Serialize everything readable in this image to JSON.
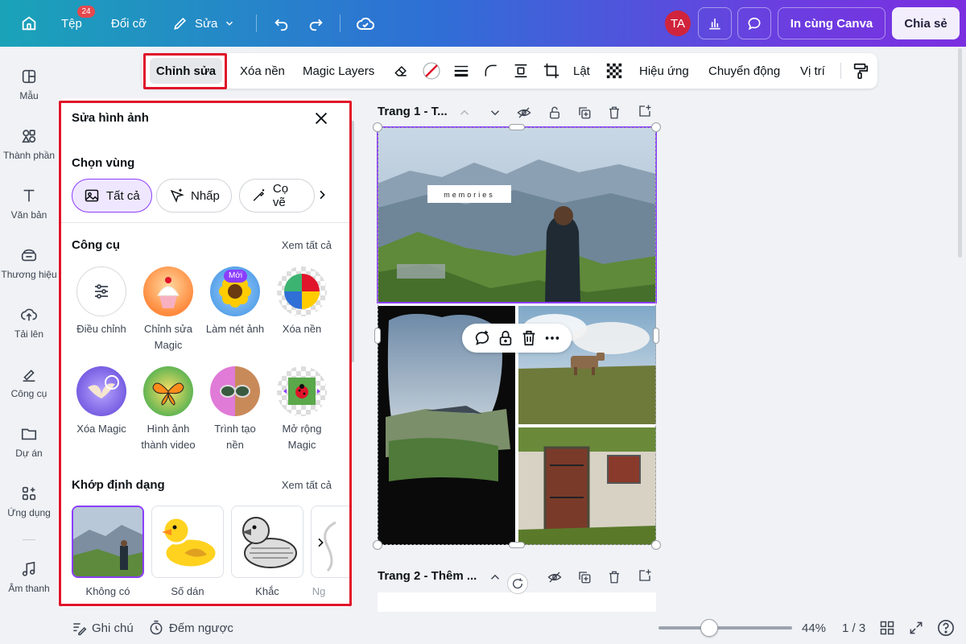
{
  "topbar": {
    "file_label": "Tệp",
    "file_badge": "24",
    "resize_label": "Đổi cỡ",
    "edit_label": "Sửa",
    "avatar_initials": "TA",
    "print_label": "In cùng Canva",
    "share_label": "Chia sẻ"
  },
  "sidebar": {
    "items": [
      {
        "label": "Mẫu",
        "icon": "template-icon"
      },
      {
        "label": "Thành phần",
        "icon": "elements-icon"
      },
      {
        "label": "Văn bản",
        "icon": "text-icon"
      },
      {
        "label": "Thương hiệu",
        "icon": "brand-icon"
      },
      {
        "label": "Tải lên",
        "icon": "upload-icon"
      },
      {
        "label": "Công cụ",
        "icon": "tools-icon"
      },
      {
        "label": "Dự án",
        "icon": "folder-icon"
      },
      {
        "label": "Ứng dụng",
        "icon": "apps-icon"
      },
      {
        "label": "Âm thanh",
        "icon": "music-icon"
      }
    ]
  },
  "context_toolbar": {
    "edit": "Chỉnh sửa",
    "remove_bg": "Xóa nền",
    "magic_layers": "Magic Layers",
    "flip": "Lật",
    "effects": "Hiệu ứng",
    "animate": "Chuyển động",
    "position": "Vị trí"
  },
  "panel": {
    "title": "Sửa hình ảnh",
    "select_area_title": "Chọn vùng",
    "chips": [
      "Tất cả",
      "Nhấp",
      "Cọ vẽ"
    ],
    "tools_title": "Công cụ",
    "see_all": "Xem tất cả",
    "new_badge": "Mới",
    "tools": [
      {
        "line1": "Điều chỉnh",
        "line2": ""
      },
      {
        "line1": "Chỉnh sửa",
        "line2": "Magic"
      },
      {
        "line1": "Làm nét ảnh",
        "line2": ""
      },
      {
        "line1": "Xóa nền",
        "line2": ""
      },
      {
        "line1": "Xóa Magic",
        "line2": ""
      },
      {
        "line1": "Hình ảnh",
        "line2": "thành video"
      },
      {
        "line1": "Trình tạo",
        "line2": "nền"
      },
      {
        "line1": "Mở rộng",
        "line2": "Magic"
      }
    ],
    "styles_title": "Khớp định dạng",
    "styles_see_all": "Xem tất cả",
    "styles": [
      "Không có",
      "Số dán",
      "Khắc",
      "Ng"
    ]
  },
  "canvas": {
    "page1_title": "Trang 1 - T...",
    "page2_title": "Trang 2 - Thêm ...",
    "memories_text": "memories"
  },
  "bottombar": {
    "notes": "Ghi chú",
    "timer": "Đếm ngược",
    "zoom": "44%",
    "page_count": "1 / 3",
    "zoom_fraction": 0.38
  }
}
